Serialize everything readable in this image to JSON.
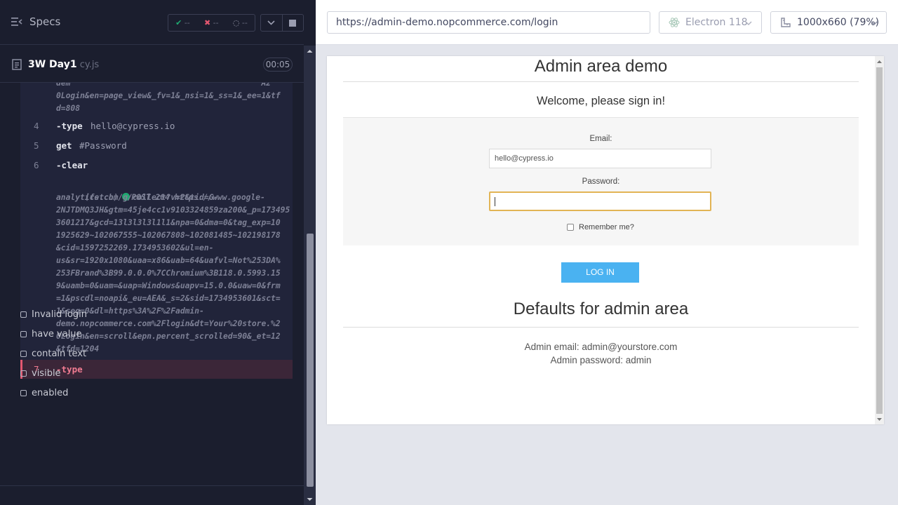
{
  "runner": {
    "header": {
      "title": "Specs"
    },
    "stats": {
      "passed": "--",
      "failed": "--",
      "pending": "--"
    },
    "spec": {
      "name": "3W Day1",
      "ext": " cy.js",
      "time": "00:05"
    },
    "log": {
      "prev_wrap": "dem                                        A2\n0Login&en=page_view&_fv=1&_nsi=1&_ss=1&_ee=1&tf\nd=808",
      "commands": [
        {
          "num": "4",
          "name": "-type",
          "arg": "hello@cypress.io"
        },
        {
          "num": "5",
          "name": "get",
          "arg": "#Password"
        },
        {
          "num": "6",
          "name": "-clear",
          "arg": ""
        },
        {
          "num": "7",
          "name": "-type",
          "arg": ""
        }
      ],
      "fetch_prefix": "(fetch)",
      "fetch_first": "POST 204 https://www.google-",
      "fetch_body": "analytics.com/g/collect?v=2&tid=G-\n2NJTDMQ3JH&gtm=45je4cc1v9103324859za200&_p=173495\n3601217&gcd=13l3l3l3l1l1&npa=0&dma=0&tag_exp=10\n1925629~102067555~102067808~102081485~102198178\n&cid=1597252269.1734953602&ul=en-\nus&sr=1920x1080&uaa=x86&uab=64&uafvl=Not%253DA%\n253FBrand%3B99.0.0.0%7CChromium%3B118.0.5993.15\n9&uamb=0&uam=&uap=Windows&uapv=15.0.0&uaw=0&frm\n=1&pscdl=noapi&_eu=AEA&_s=2&sid=1734953601&sct=\n1&seg=0&dl=https%3A%2F%2Fadmin-\ndemo.nopcommerce.com%2Flogin&dt=Your%20store.%2\n0Login&en=scroll&epn.percent_scrolled=90&_et=12\n&tfd=1204"
    },
    "tests": [
      "Invalid login",
      "have value",
      "contain text",
      "visible",
      "enabled"
    ]
  },
  "aut": {
    "url": "https://admin-demo.nopcommerce.com/login",
    "browser": "Electron 118",
    "viewport": "1000x660  (79%)"
  },
  "page": {
    "title": "Admin area demo",
    "welcome": "Welcome, please sign in!",
    "email_label": "Email:",
    "email_value": "hello@cypress.io",
    "password_label": "Password:",
    "remember_label": "Remember me?",
    "login_button": "LOG IN",
    "defaults_title": "Defaults for admin area",
    "admin_email": "Admin email: admin@yourstore.com",
    "admin_password": "Admin password: admin"
  },
  "colors": {
    "runner_bg": "#1b1e2e",
    "pass": "#1fa971",
    "fail": "#e45770",
    "login_button": "#4ab2f1",
    "focus_border": "#e2b455"
  }
}
